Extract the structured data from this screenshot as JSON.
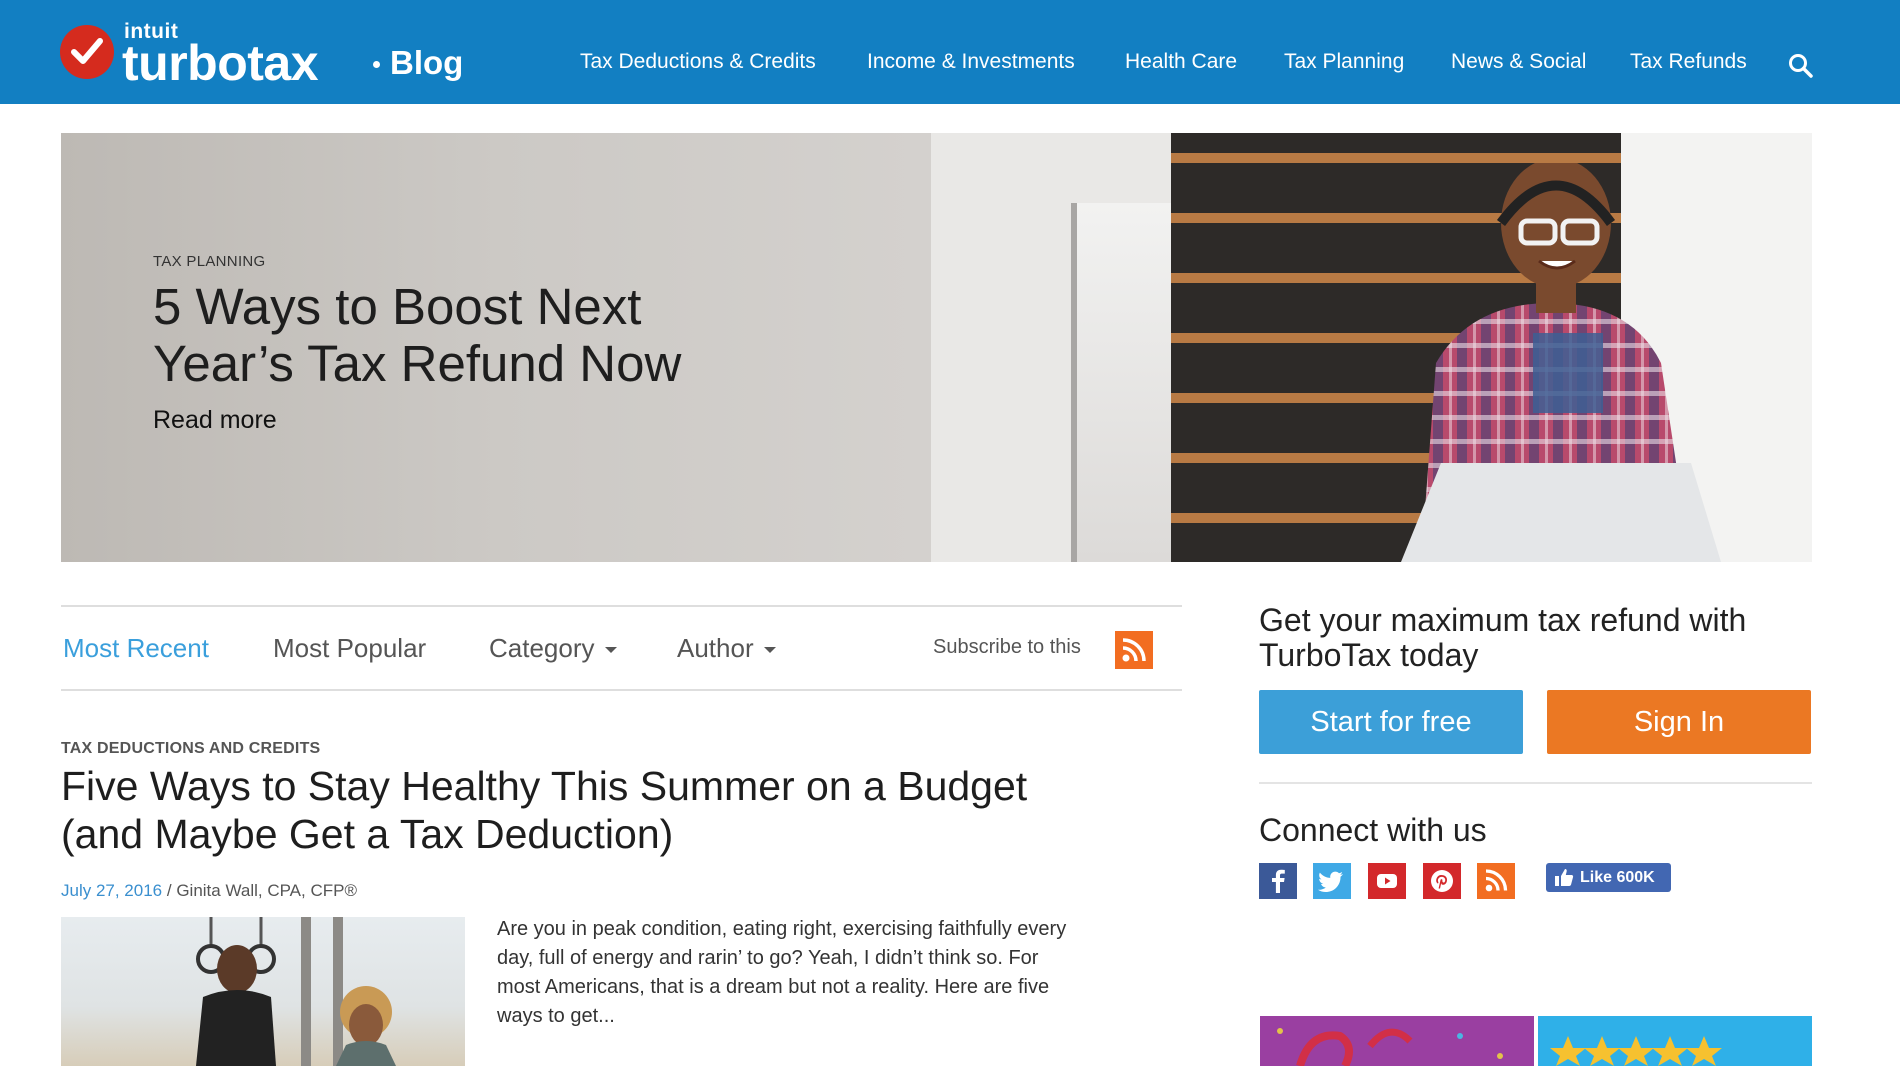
{
  "header": {
    "logo_intuit": "intuit",
    "logo_turbotax": "turbotax",
    "logo_blog": "Blog",
    "nav": [
      {
        "label": "Tax Deductions & Credits"
      },
      {
        "label": "Income & Investments"
      },
      {
        "label": "Health Care"
      },
      {
        "label": "Tax Planning"
      },
      {
        "label": "News & Social"
      },
      {
        "label": "Tax Refunds"
      }
    ],
    "search_icon": "search-icon",
    "brand_color": "#127fc2"
  },
  "hero": {
    "category": "TAX PLANNING",
    "title": "5 Ways to Boost Next Year’s Tax Refund Now",
    "read_more": "Read more"
  },
  "tabs": {
    "items": [
      {
        "label": "Most Recent",
        "active": true
      },
      {
        "label": "Most Popular",
        "active": false
      },
      {
        "label": "Category",
        "dropdown": true
      },
      {
        "label": "Author",
        "dropdown": true
      }
    ],
    "subscribe_label": "Subscribe to this",
    "subscribe_icon": "rss-icon"
  },
  "article": {
    "category": "TAX DEDUCTIONS AND CREDITS",
    "title": "Five Ways to Stay Healthy This Summer on a Budget (and Maybe Get a Tax Deduction)",
    "date": "July 27, 2016",
    "separator": " / ",
    "author": "Ginita Wall, CPA, CFP®",
    "excerpt": "Are you in peak condition, eating right, exercising faithfully every day, full of energy and rarin’ to go? Yeah, I didn’t think so. For most Americans, that is a dream but not a reality. Here are five ways to get..."
  },
  "sidebar": {
    "promo_text": "Get your maximum tax refund with TurboTax today",
    "start_button": "Start for free",
    "signin_button": "Sign In",
    "connect_heading": "Connect with us",
    "social_icons": [
      "facebook-icon",
      "twitter-icon",
      "youtube-icon",
      "pinterest-icon",
      "rss-icon"
    ],
    "like_button": "Like 600K",
    "colors": {
      "start": "#3c9fd8",
      "signin": "#eb7823"
    }
  }
}
